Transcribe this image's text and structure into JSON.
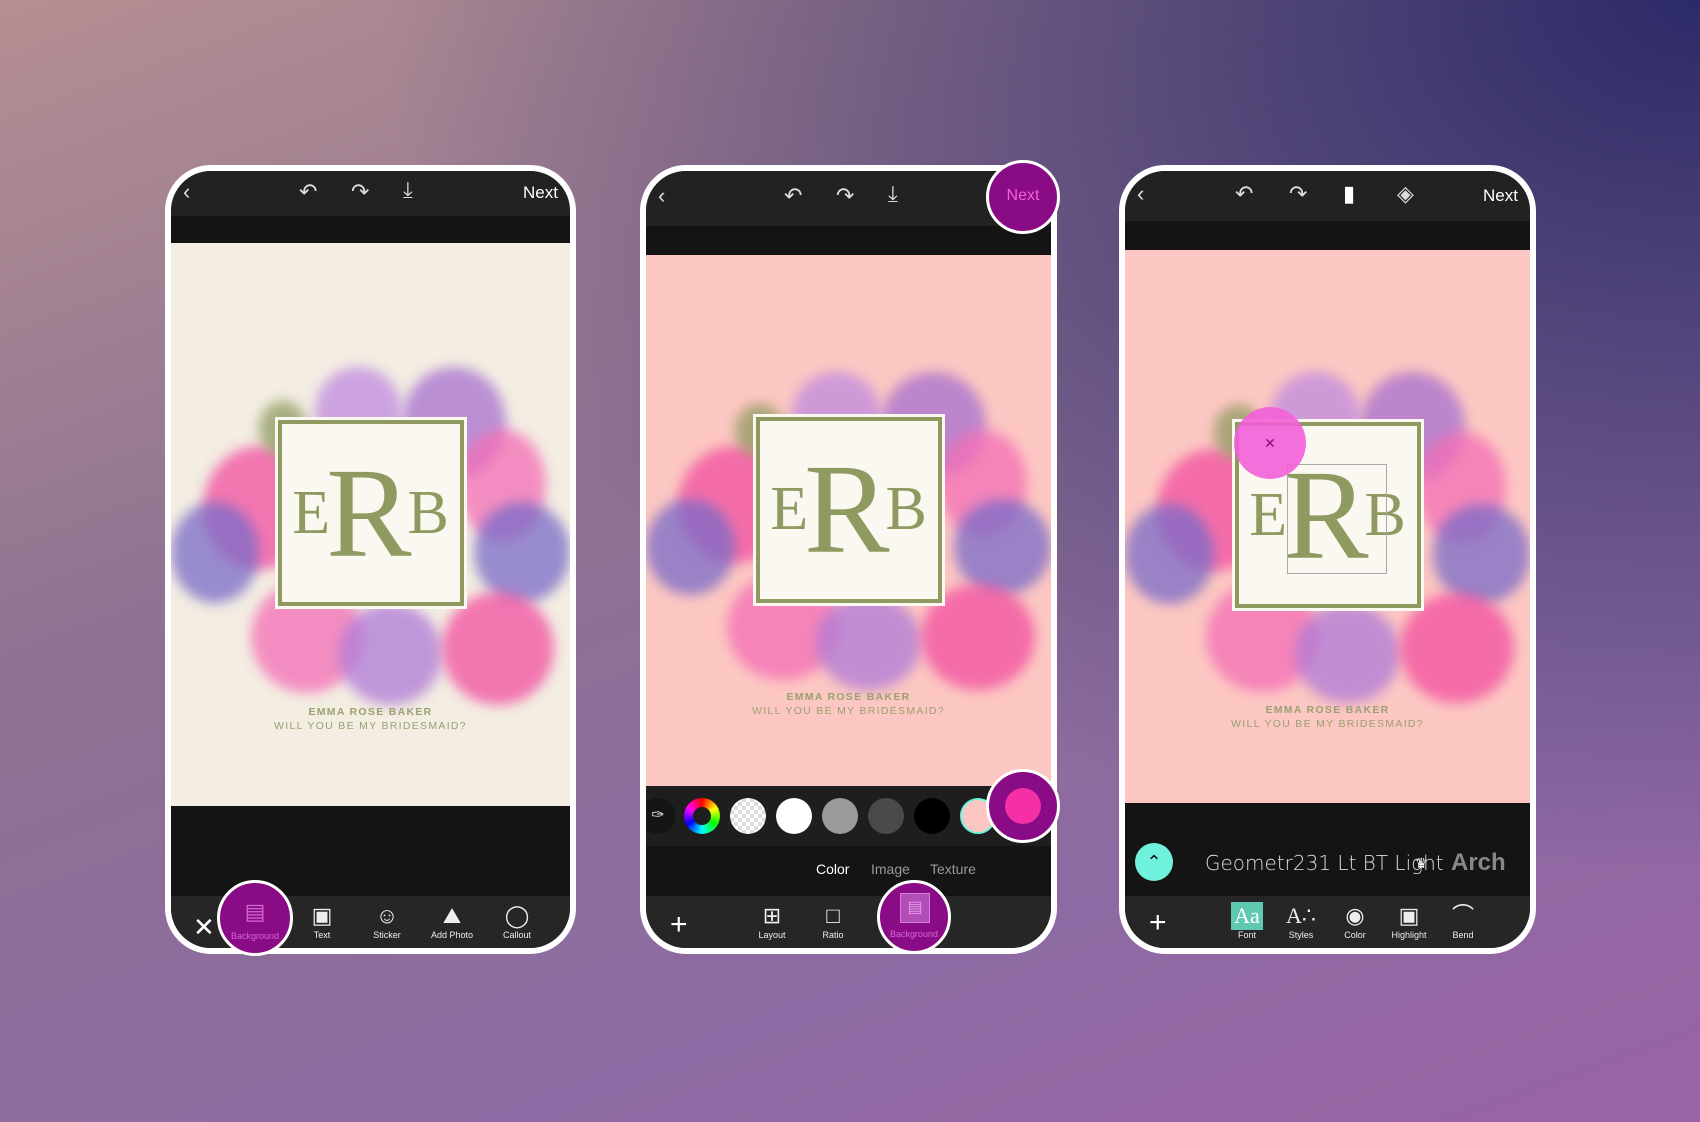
{
  "screens": [
    {
      "top": {
        "next_label": "Next",
        "icons": [
          "back-icon",
          "undo-icon",
          "redo-icon",
          "download-icon"
        ]
      },
      "card": {
        "monogram": [
          "E",
          "R",
          "B"
        ],
        "name": "EMMA ROSE BAKER",
        "question": "WILL YOU BE MY BRIDESMAID?",
        "background": "#f3ede2"
      },
      "toolbar": [
        {
          "label": "Background",
          "icon": "background-icon",
          "active": true
        },
        {
          "label": "Text",
          "icon": "text-icon"
        },
        {
          "label": "Sticker",
          "icon": "sticker-icon"
        },
        {
          "label": "Add Photo",
          "icon": "add-photo-icon"
        },
        {
          "label": "Callout",
          "icon": "callout-icon"
        }
      ],
      "close_icon": "close-icon"
    },
    {
      "top": {
        "next_label": "Next",
        "icons": [
          "back-icon",
          "undo-icon",
          "redo-icon",
          "download-icon"
        ]
      },
      "card": {
        "monogram": [
          "E",
          "R",
          "B"
        ],
        "name": "EMMA ROSE BAKER",
        "question": "WILL YOU BE MY BRIDESMAID?",
        "background": "#fcc7c2"
      },
      "swatches": [
        "eyedropper",
        "color-wheel",
        "transparent",
        "#ffffff",
        "#9a9a9a",
        "#4a4a4a",
        "#000000",
        "#fcc7c2",
        "#f52fa6"
      ],
      "tabs": [
        "Color",
        "Image",
        "Texture"
      ],
      "active_tab": "Color",
      "toolbar": [
        {
          "label": "Layout",
          "icon": "layout-icon"
        },
        {
          "label": "Ratio",
          "icon": "ratio-icon"
        },
        {
          "label": "Background",
          "icon": "background-icon",
          "active": true
        }
      ]
    },
    {
      "top": {
        "next_label": "Next",
        "icons": [
          "back-icon",
          "undo-icon",
          "redo-icon",
          "eraser-icon",
          "layers-icon"
        ]
      },
      "card": {
        "monogram": [
          "E",
          "R",
          "B"
        ],
        "name": "EMMA ROSE BAKER",
        "question": "WILL YOU BE MY BRIDESMAID?",
        "background": "#fcc7c2"
      },
      "fonts": {
        "current": "Geometr231 Lt BT Light",
        "next": "Arch"
      },
      "toolbar": [
        {
          "label": "Font",
          "icon": "font-icon",
          "active": true
        },
        {
          "label": "Styles",
          "icon": "styles-icon"
        },
        {
          "label": "Color",
          "icon": "color-icon"
        },
        {
          "label": "Highlight",
          "icon": "highlight-icon"
        },
        {
          "label": "Bend",
          "icon": "bend-icon"
        }
      ]
    }
  ],
  "colors": {
    "highlight": "#8a0b86",
    "accent_pink": "#f35fd8",
    "teal": "#6ff2dc",
    "olive": "#8e9a5f"
  }
}
